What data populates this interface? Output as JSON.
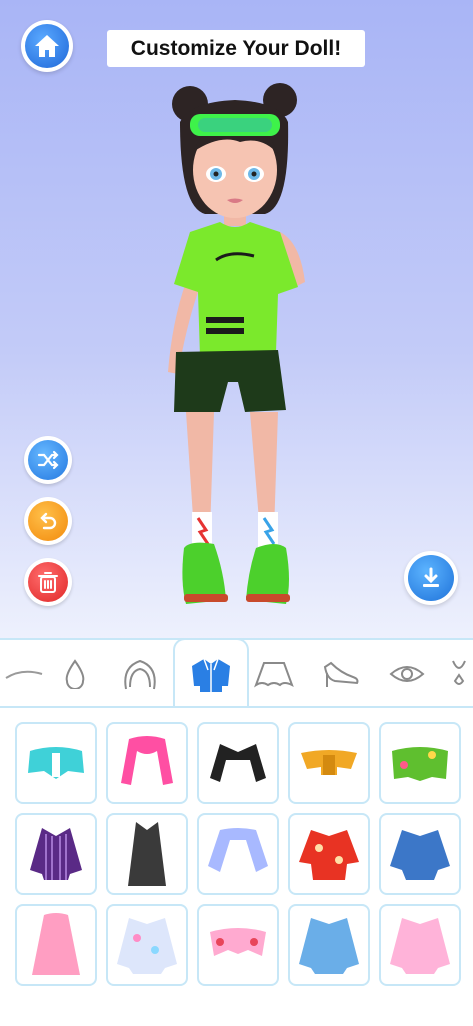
{
  "header": {
    "title": "Customize Your Doll!",
    "home_icon": "home-icon"
  },
  "side_buttons": [
    {
      "name": "shuffle-button",
      "icon": "shuffle-icon",
      "color": "#2478e0"
    },
    {
      "name": "undo-button",
      "icon": "undo-icon",
      "color": "#f28a0c"
    },
    {
      "name": "delete-button",
      "icon": "trash-icon",
      "color": "#e02727"
    }
  ],
  "download": {
    "icon": "download-icon",
    "color": "#1f72d9"
  },
  "tabs": [
    {
      "icon": "eyebrow-icon",
      "active": false
    },
    {
      "icon": "drop-icon",
      "active": false
    },
    {
      "icon": "hair-icon",
      "active": false
    },
    {
      "icon": "jacket-icon",
      "active": true
    },
    {
      "icon": "skirt-icon",
      "active": false
    },
    {
      "icon": "heel-shoe-icon",
      "active": false
    },
    {
      "icon": "eye-icon",
      "active": false
    },
    {
      "icon": "necklace-icon",
      "active": false
    }
  ],
  "items": [
    "teal-puffer-jacket",
    "pink-shrug",
    "black-leather-jacket",
    "yellow-crop-jacket",
    "green-patch-jacket",
    "purple-striped-blazer",
    "black-long-coat",
    "pastel-sleeve-shrug",
    "red-floral-kimono",
    "blue-denim-jacket",
    "pink-fur-coat",
    "pastel-patch-jacket",
    "pink-floral-shrug",
    "blue-denim-patch-jacket",
    "pink-oversized-jacket"
  ],
  "accent": "#2a7fe4"
}
